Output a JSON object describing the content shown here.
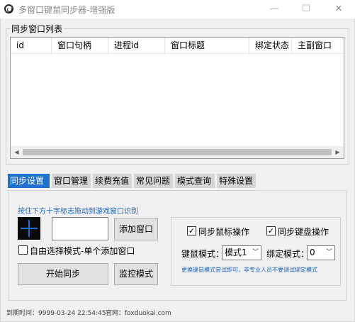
{
  "window": {
    "title": "多窗口键鼠同步器-增强版",
    "controls": {
      "minimize": "—",
      "maximize": "☐",
      "close": "✕"
    }
  },
  "list_group": {
    "label": "同步窗口列表",
    "columns": [
      "id",
      "窗口句柄",
      "进程id",
      "窗口标题",
      "绑定状态",
      "主副窗口"
    ]
  },
  "tabs": [
    "同步设置",
    "窗口管理",
    "续费充值",
    "常见问题",
    "模式查询",
    "特殊设置"
  ],
  "active_tab": "同步设置",
  "sync_panel": {
    "drag_hint": "按住下方十字标志拖动到游戏窗口识别",
    "crosshair_icon": "crosshair-icon",
    "handle_input_value": "",
    "add_window_button": "添加窗口",
    "free_select_checkbox": {
      "label": "自由选择模式-单个添加窗口",
      "checked": false
    },
    "start_sync_button": "开始同步",
    "monitor_mode_button": "监控模式",
    "options": {
      "mouse_sync": {
        "label": "同步鼠标操作",
        "checked": true
      },
      "keyboard_sync": {
        "label": "同步键盘操作",
        "checked": true
      },
      "keymouse_mode_label": "键鼠模式：",
      "keymouse_mode_value": "模式1",
      "bind_mode_label": "绑定模式：",
      "bind_mode_value": "0",
      "note": "更换键鼠模式尝试即可，非专业人员不要调试绑定模式"
    }
  },
  "statusbar": {
    "expiry_label": "到期时间：",
    "expiry_value": "9999-03-24 22:54:45",
    "website_label": "官网：",
    "website_value": "foxduokai.com"
  },
  "colors": {
    "active_tab_bg": "#1e73d2",
    "hint_text": "#1766c9",
    "crosshair_bg": "#0a0a0a",
    "crosshair_line": "#1f6fd6"
  }
}
